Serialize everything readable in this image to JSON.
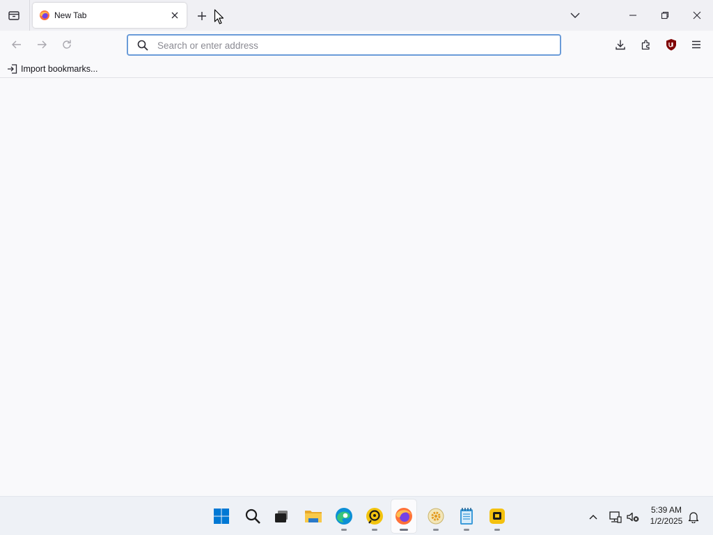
{
  "tabs": [
    {
      "title": "New Tab",
      "active": true
    }
  ],
  "urlbar": {
    "placeholder": "Search or enter address",
    "value": ""
  },
  "bookmarks_bar": {
    "items": [
      {
        "label": "Import bookmarks..."
      }
    ]
  },
  "toolbar": {
    "icons": [
      "download-icon",
      "extensions-icon",
      "ublock-origin-icon",
      "hamburger-menu-icon"
    ]
  },
  "taskbar": {
    "apps": [
      {
        "name": "start-button",
        "running": false
      },
      {
        "name": "search",
        "running": false
      },
      {
        "name": "task-view",
        "running": false
      },
      {
        "name": "file-explorer",
        "running": false
      },
      {
        "name": "edge",
        "running": true
      },
      {
        "name": "app-yellow",
        "running": true
      },
      {
        "name": "firefox",
        "running": true,
        "active": true
      },
      {
        "name": "app-gear",
        "running": true
      },
      {
        "name": "notepad",
        "running": true
      },
      {
        "name": "app-yellow-box",
        "running": true
      }
    ],
    "clock": {
      "time": "5:39 AM",
      "date": "1/2/2025"
    }
  },
  "colors": {
    "urlbar_focus": "#6a9bd8",
    "ublock_red": "#800000",
    "windows_blue": "#0078d4"
  }
}
